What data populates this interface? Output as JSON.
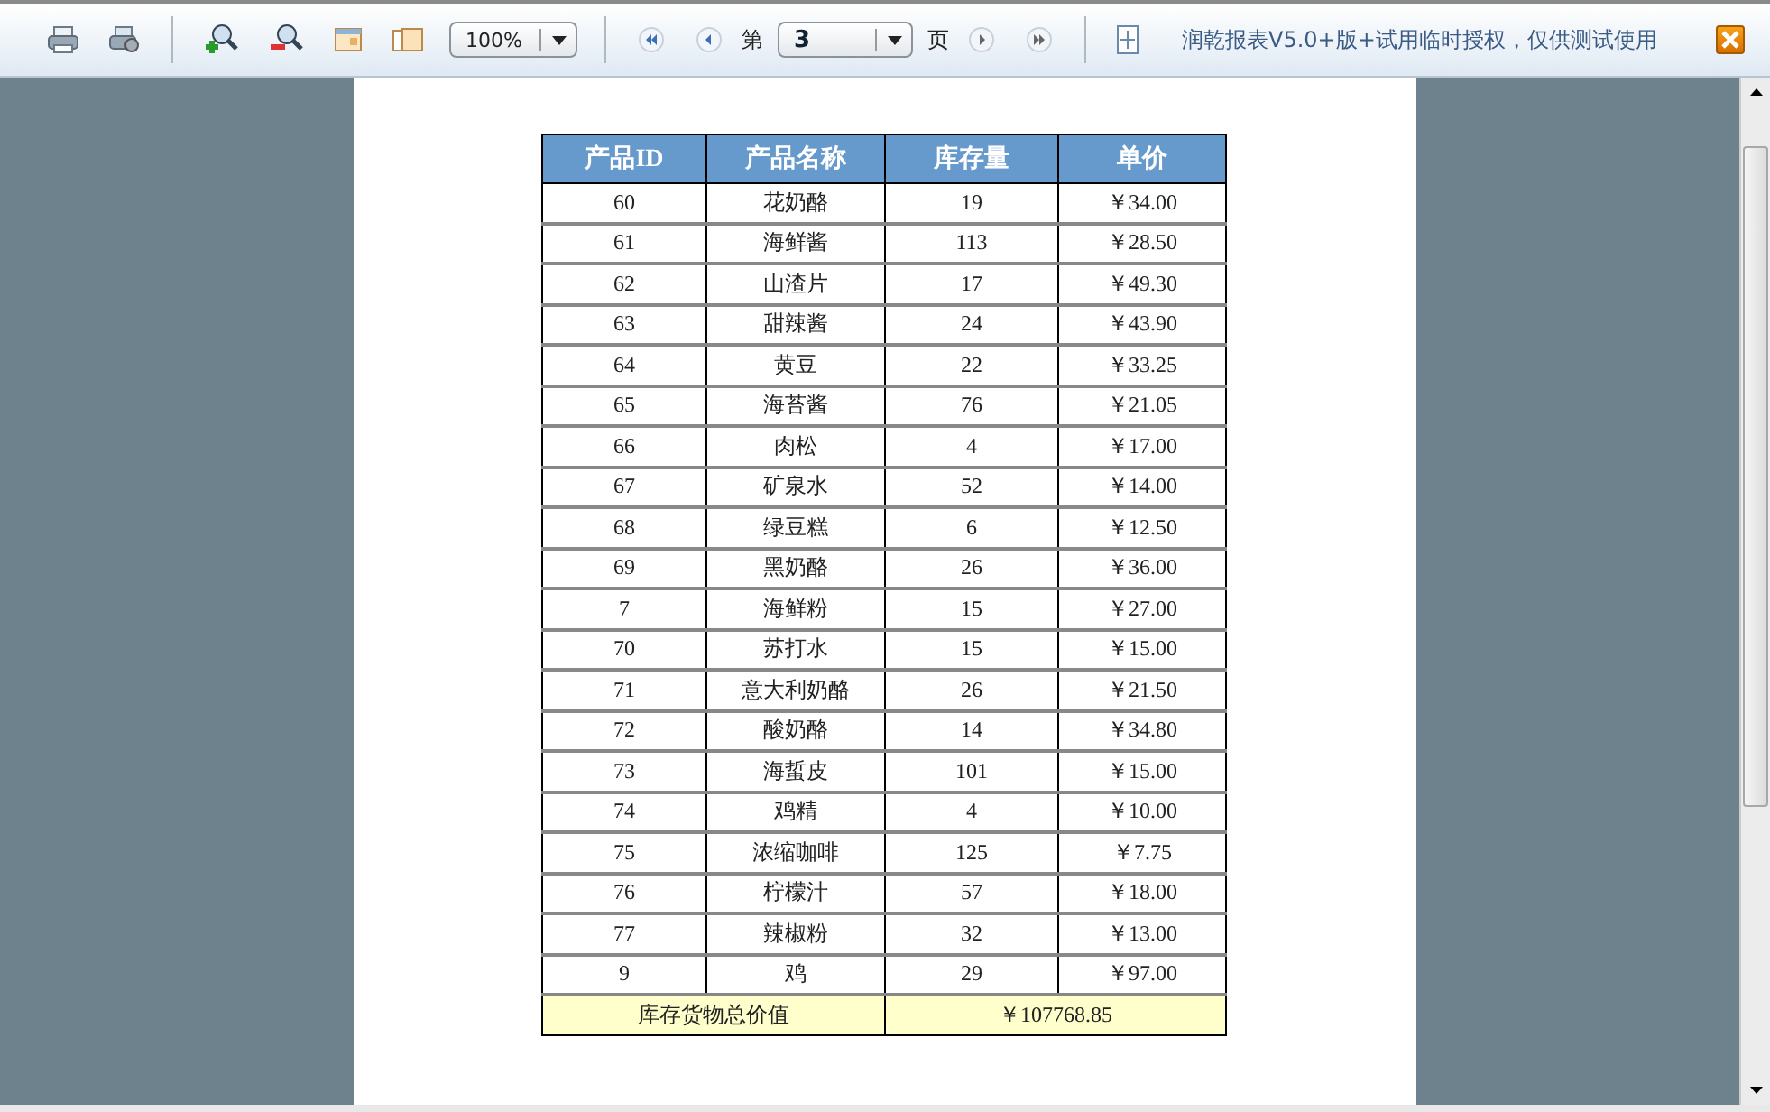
{
  "toolbar": {
    "zoom": "100%",
    "page_prefix": "第",
    "page": "3",
    "page_suffix": "页",
    "license": "润乾报表V5.0+版+试用临时授权，仅供测试使用"
  },
  "table": {
    "columns": [
      "产品ID",
      "产品名称",
      "库存量",
      "单价"
    ],
    "rows": [
      [
        "60",
        "花奶酪",
        "19",
        "￥34.00"
      ],
      [
        "61",
        "海鲜酱",
        "113",
        "￥28.50"
      ],
      [
        "62",
        "山渣片",
        "17",
        "￥49.30"
      ],
      [
        "63",
        "甜辣酱",
        "24",
        "￥43.90"
      ],
      [
        "64",
        "黄豆",
        "22",
        "￥33.25"
      ],
      [
        "65",
        "海苔酱",
        "76",
        "￥21.05"
      ],
      [
        "66",
        "肉松",
        "4",
        "￥17.00"
      ],
      [
        "67",
        "矿泉水",
        "52",
        "￥14.00"
      ],
      [
        "68",
        "绿豆糕",
        "6",
        "￥12.50"
      ],
      [
        "69",
        "黑奶酪",
        "26",
        "￥36.00"
      ],
      [
        "7",
        "海鲜粉",
        "15",
        "￥27.00"
      ],
      [
        "70",
        "苏打水",
        "15",
        "￥15.00"
      ],
      [
        "71",
        "意大利奶酪",
        "26",
        "￥21.50"
      ],
      [
        "72",
        "酸奶酪",
        "14",
        "￥34.80"
      ],
      [
        "73",
        "海蜇皮",
        "101",
        "￥15.00"
      ],
      [
        "74",
        "鸡精",
        "4",
        "￥10.00"
      ],
      [
        "75",
        "浓缩咖啡",
        "125",
        "￥7.75"
      ],
      [
        "76",
        "柠檬汁",
        "57",
        "￥18.00"
      ],
      [
        "77",
        "辣椒粉",
        "32",
        "￥13.00"
      ],
      [
        "9",
        "鸡",
        "29",
        "￥97.00"
      ]
    ],
    "footer": {
      "label": "库存货物总价值",
      "value": "￥107768.85"
    }
  }
}
